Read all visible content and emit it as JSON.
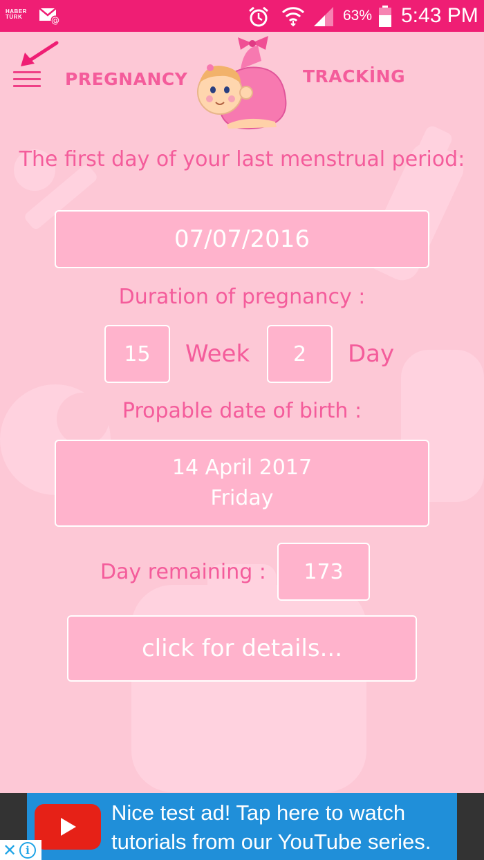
{
  "status_bar": {
    "app_badge_line1": "HABER",
    "app_badge_line2": "TÜRK",
    "battery_percent": "63%",
    "time": "5:43 PM"
  },
  "header": {
    "title_left": "PREGNANCY",
    "title_right": "TRACKİNG"
  },
  "form": {
    "lmp_label": "The first day of your last menstrual period:",
    "lmp_value": "07/07/2016",
    "duration_label": "Duration of pregnancy :",
    "weeks_value": "15",
    "weeks_unit": "Week",
    "days_value": "2",
    "days_unit": "Day",
    "birth_label": "Propable date of birth :",
    "birth_date": "14 April 2017",
    "birth_weekday": "Friday",
    "remaining_label": "Day remaining :",
    "remaining_value": "173",
    "details_button": "click for details..."
  },
  "ad": {
    "text": "Nice test ad!  Tap here to watch tutorials from our YouTube series."
  },
  "colors": {
    "status_bar": "#ef1e74",
    "background": "#fdc8d6",
    "accent_text": "#f45c9b",
    "box_fill": "#ffb3cc",
    "ad_background": "#208fd9"
  }
}
